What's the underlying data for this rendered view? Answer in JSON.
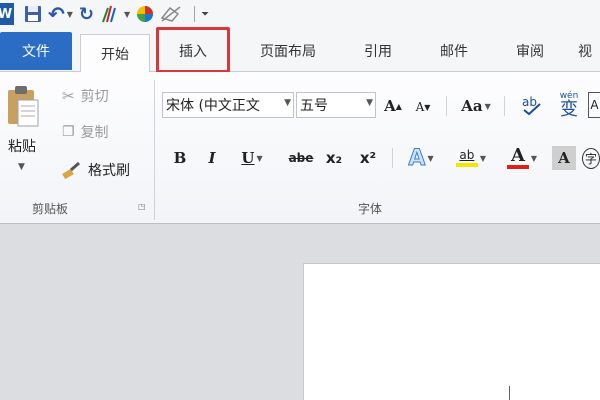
{
  "qat": {
    "logo": "W",
    "undo": "↶",
    "redo": "↻"
  },
  "tabs": {
    "file": "文件",
    "home": "开始",
    "insert": "插入",
    "layout": "页面布局",
    "references": "引用",
    "mailings": "邮件",
    "review": "审阅",
    "view": "视"
  },
  "clipboard": {
    "paste": "粘贴",
    "cut": "剪切",
    "copy": "复制",
    "format_painter": "格式刷",
    "group_label": "剪贴板"
  },
  "font": {
    "font_name": "宋体 (中文正文",
    "font_size": "五号",
    "grow": "A",
    "shrink": "A",
    "change_case": "Aa",
    "bold": "B",
    "italic": "I",
    "underline": "U",
    "strikethrough": "abe",
    "subscript": "x₂",
    "superscript": "x²",
    "text_effects": "A",
    "highlight": "ab",
    "font_color": "A",
    "char_shading": "A",
    "enclose": "字",
    "phonetic_top": "wén",
    "phonetic_bottom": "变",
    "group_label": "字体"
  },
  "colors": {
    "file_tab": "#2b6cc4",
    "highlight_box": "#d9383a",
    "font_color_bar": "#e0201b",
    "highlight_bar": "#f5e600"
  }
}
